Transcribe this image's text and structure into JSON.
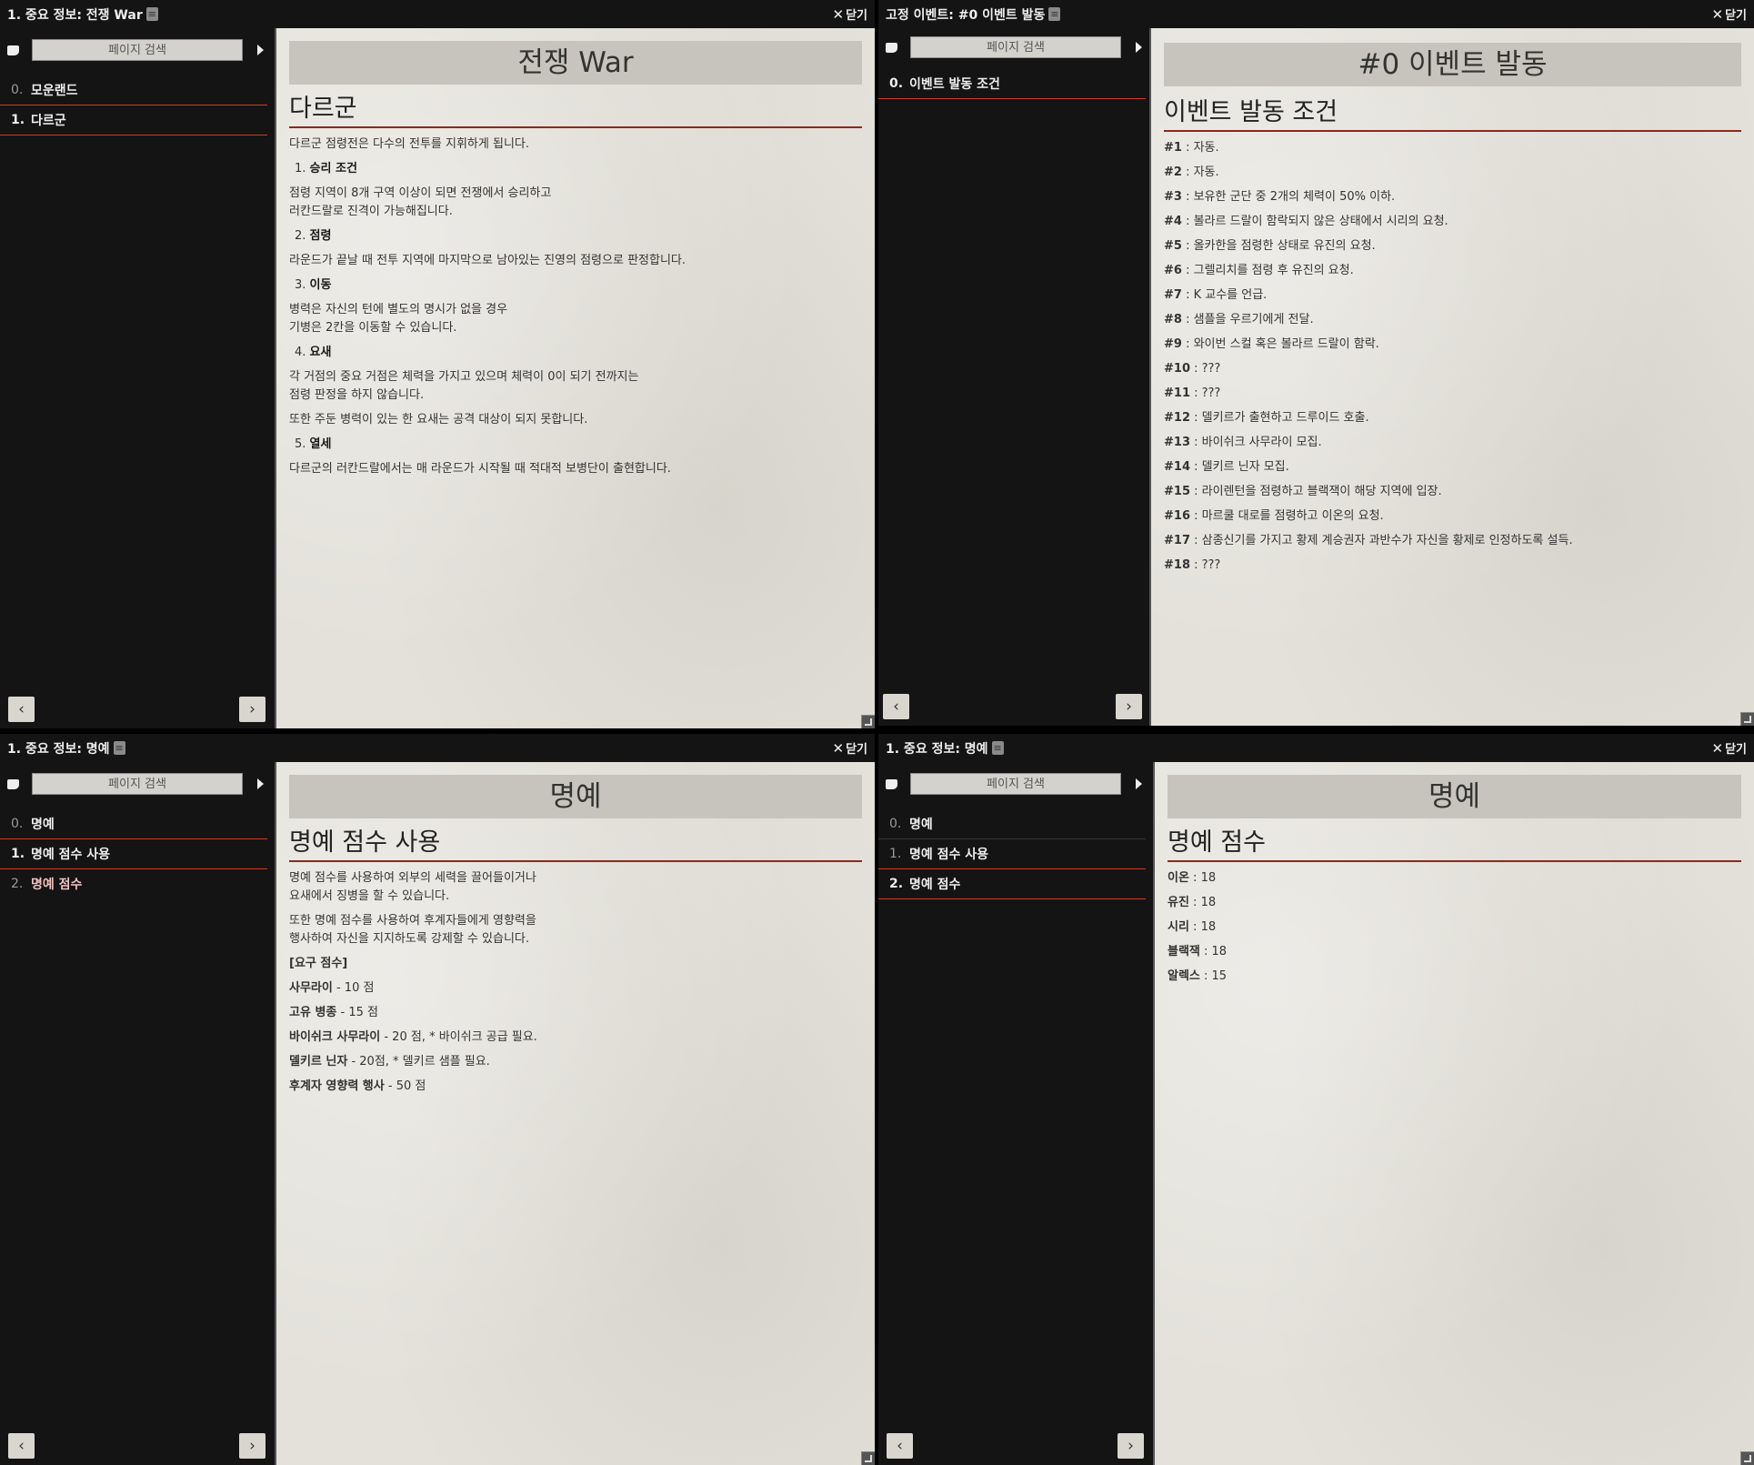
{
  "windows": [
    {
      "title": "1. 중요 정보: 전쟁 War",
      "close": "닫기",
      "search_placeholder": "페이지 검색",
      "nav": [
        {
          "num": "0.",
          "label": "모운랜드"
        },
        {
          "num": "1.",
          "label": "다르군"
        }
      ],
      "banner": "전쟁 War",
      "heading": "다르군",
      "intro": "다르군 점령전은 다수의 전투를 지휘하게 됩니다.",
      "sections": [
        {
          "num": "1.",
          "title": "승리 조건",
          "lines": [
            "점령 지역이 8개 구역 이상이 되면 전쟁에서 승리하고",
            "러칸드랄로 진격이 가능해집니다."
          ]
        },
        {
          "num": "2.",
          "title": "점령",
          "lines": [
            "라운드가 끝날 때 전투 지역에 마지막으로 남아있는 진영의 점령으로 판정합니다."
          ]
        },
        {
          "num": "3.",
          "title": "이동",
          "lines": [
            "병력은 자신의 턴에 별도의 명시가 없을 경우",
            "기병은 2칸을 이동할 수 있습니다."
          ]
        },
        {
          "num": "4.",
          "title": "요새",
          "lines": [
            "각 거점의 중요 거점은 체력을 가지고 있으며 체력이 0이 되기 전까지는",
            "점령 판정을 하지 않습니다."
          ],
          "extra": "또한 주둔 병력이 있는 한 요새는 공격 대상이 되지 못합니다."
        },
        {
          "num": "5.",
          "title": "열세",
          "lines": [
            "다르군의 러칸드랄에서는 매 라운드가 시작될 때 적대적 보병단이 출현합니다."
          ]
        }
      ]
    },
    {
      "title": "고정 이벤트: #0 이벤트 발동",
      "close": "닫기",
      "search_placeholder": "페이지 검색",
      "nav": [
        {
          "num": "0.",
          "label": "이벤트 발동 조건"
        }
      ],
      "banner": "#0 이벤트 발동",
      "heading": "이벤트 발동 조건",
      "events": [
        {
          "k": "#1",
          "v": " : 자동."
        },
        {
          "k": "#2",
          "v": " : 자동."
        },
        {
          "k": "#3",
          "v": " : 보유한 군단 중 2개의 체력이 50% 이하."
        },
        {
          "k": "#4",
          "v": " : 볼라르 드랄이 함락되지 않은 상태에서 시리의 요청."
        },
        {
          "k": "#5",
          "v": " : 올카한을 점령한 상태로 유진의 요청."
        },
        {
          "k": "#6",
          "v": " : 그렐리치를 점령 후 유진의 요청."
        },
        {
          "k": "#7",
          "v": " : K 교수를 언급."
        },
        {
          "k": "#8",
          "v": " : 샘플을 우르기에게 전달."
        },
        {
          "k": "#9",
          "v": " : 와이번 스컬 혹은 볼라르 드랄이 함락."
        },
        {
          "k": "#10",
          "v": " : ???"
        },
        {
          "k": "#11",
          "v": " : ???"
        },
        {
          "k": "#12",
          "v": " : 델키르가 출현하고 드루이드 호출."
        },
        {
          "k": "#13",
          "v": " : 바이쉬크 사무라이 모집."
        },
        {
          "k": "#14",
          "v": " : 델키르 닌자 모집."
        },
        {
          "k": "#15",
          "v": " : 라이렌턴을 점령하고 블랙잭이 해당 지역에 입장."
        },
        {
          "k": "#16",
          "v": " : 마르쿨 대로를 점령하고 이온의 요청."
        },
        {
          "k": "#17",
          "v": " : 삼종신기를 가지고 황제 계승권자 과반수가 자신을 황제로 인정하도록 설득."
        },
        {
          "k": "#18",
          "v": " : ???"
        }
      ]
    },
    {
      "title": "1. 중요 정보: 명예",
      "close": "닫기",
      "search_placeholder": "페이지 검색",
      "nav": [
        {
          "num": "0.",
          "label": "명예"
        },
        {
          "num": "1.",
          "label": "명예 점수 사용"
        },
        {
          "num": "2.",
          "label": "명예 점수"
        }
      ],
      "banner": "명예",
      "heading": "명예 점수 사용",
      "paras": [
        [
          "명예 점수를 사용하여 외부의 세력을 끌어들이거나",
          "요새에서 징병을 할 수 있습니다."
        ],
        [
          "또한 명예 점수를 사용하여 후계자들에게 영향력을",
          "행사하여 자신을 지지하도록 강제할 수 있습니다."
        ]
      ],
      "req_title": "[요구 점수]",
      "reqs": [
        {
          "k": "사무라이",
          "v": " - 10 점"
        },
        {
          "k": "고유 병종",
          "v": " - 15 점"
        },
        {
          "k": "바이쉬크 사무라이",
          "v": " - 20 점, * 바이쉬크 공급 필요."
        },
        {
          "k": "델키르 닌자",
          "v": " - 20점, * 델키르 샘플 필요."
        },
        {
          "k": "후계자 영향력 행사",
          "v": " - 50 점"
        }
      ]
    },
    {
      "title": "1. 중요 정보: 명예",
      "close": "닫기",
      "search_placeholder": "페이지 검색",
      "nav": [
        {
          "num": "0.",
          "label": "명예"
        },
        {
          "num": "1.",
          "label": "명예 점수 사용"
        },
        {
          "num": "2.",
          "label": "명예 점수"
        }
      ],
      "banner": "명예",
      "heading": "명예 점수",
      "scores": [
        {
          "k": "이온",
          "v": " : 18"
        },
        {
          "k": "유진",
          "v": " : 18"
        },
        {
          "k": "시리",
          "v": " : 18"
        },
        {
          "k": "블랙잭",
          "v": " : 18"
        },
        {
          "k": "알렉스",
          "v": " : 15"
        }
      ]
    }
  ]
}
